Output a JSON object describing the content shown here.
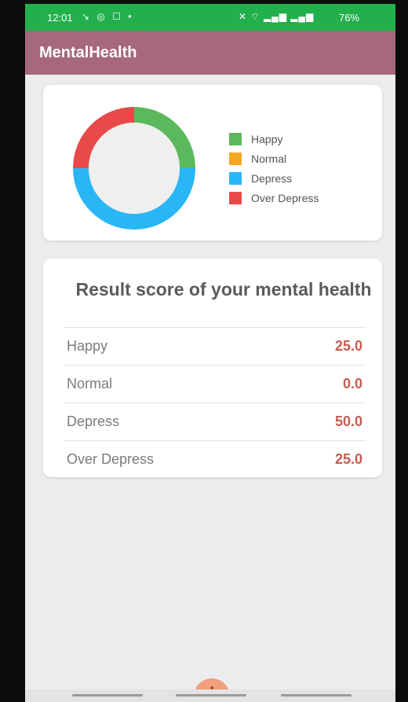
{
  "status_bar": {
    "time": "12:01",
    "left_icons": "↘ ◎ ☐ •",
    "right_icons": "✕ ⌔ ▂▄▆ ▂▄▆",
    "battery": "76%"
  },
  "app_bar": {
    "title": "MentalHealth"
  },
  "chart": {
    "legend": [
      {
        "label": "Happy",
        "color": "#5cb85c"
      },
      {
        "label": "Normal",
        "color": "#f5a623"
      },
      {
        "label": "Depress",
        "color": "#29b6f6"
      },
      {
        "label": "Over Depress",
        "color": "#e84a4a"
      }
    ]
  },
  "chart_data": {
    "type": "pie",
    "categories": [
      "Happy",
      "Normal",
      "Depress",
      "Over Depress"
    ],
    "values": [
      25.0,
      0.0,
      50.0,
      25.0
    ],
    "colors": [
      "#5cb85c",
      "#f5a623",
      "#29b6f6",
      "#e84a4a"
    ],
    "legend_position": "right",
    "donut": true
  },
  "results": {
    "title": "Result score of your mental health",
    "rows": [
      {
        "label": "Happy",
        "value": "25.0"
      },
      {
        "label": "Normal",
        "value": "0.0"
      },
      {
        "label": "Depress",
        "value": "50.0"
      },
      {
        "label": "Over Depress",
        "value": "25.0"
      }
    ]
  }
}
